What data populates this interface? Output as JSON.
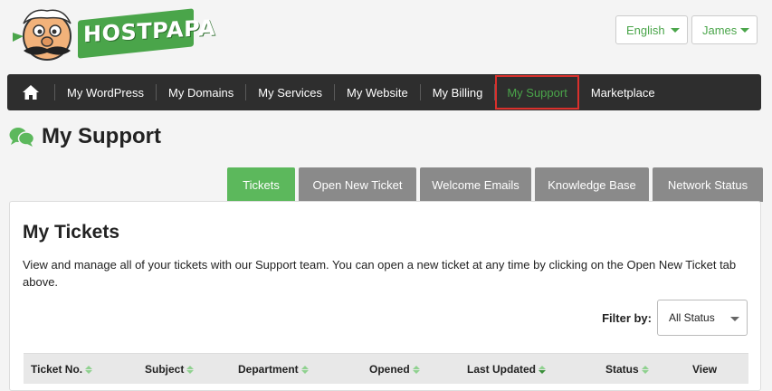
{
  "header": {
    "logo_text": "HOSTPAPA",
    "language": "English",
    "user": "James"
  },
  "nav": {
    "items": [
      {
        "label": "My WordPress"
      },
      {
        "label": "My Domains"
      },
      {
        "label": "My Services"
      },
      {
        "label": "My Website"
      },
      {
        "label": "My Billing"
      },
      {
        "label": "My Support",
        "active": true
      },
      {
        "label": "Marketplace"
      }
    ]
  },
  "page": {
    "title": "My Support",
    "icon": "chat-bubbles-icon"
  },
  "tabs": [
    {
      "label": "Tickets",
      "active": true
    },
    {
      "label": "Open New Ticket"
    },
    {
      "label": "Welcome Emails"
    },
    {
      "label": "Knowledge Base"
    },
    {
      "label": "Network Status"
    }
  ],
  "panel": {
    "heading": "My Tickets",
    "description": "View and manage all of your tickets with our Support team. You can open a new ticket at any time by clicking on the Open New Ticket tab above.",
    "filter_label": "Filter by:",
    "filter_value": "All Status"
  },
  "table": {
    "columns": [
      "Ticket No.",
      "Subject",
      "Department",
      "Opened",
      "Last Updated",
      "Status",
      "View"
    ]
  },
  "colors": {
    "brand_green": "#4aa54a",
    "nav_bg": "#2e2e2e",
    "active_highlight": "#d9302c",
    "tab_active": "#5cb85c",
    "tab_inactive": "#8a8a8a"
  }
}
